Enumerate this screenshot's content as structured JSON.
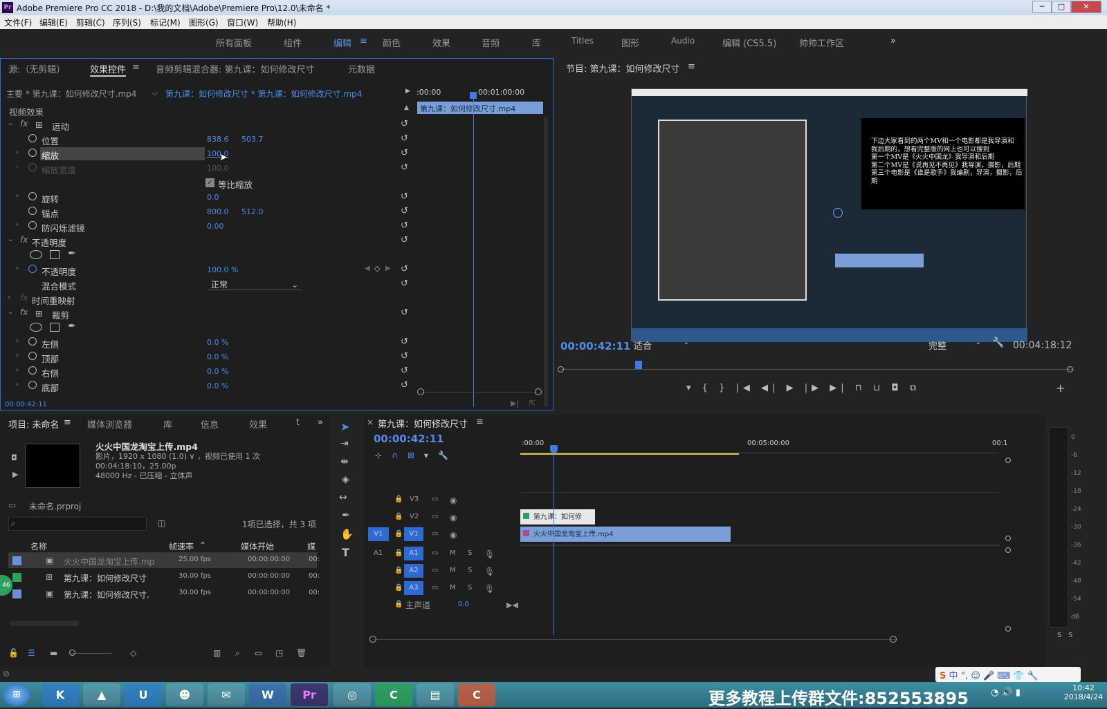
{
  "titlebar": {
    "app_icon": "Pr",
    "title": "Adobe Premiere Pro CC 2018 - D:\\我的文档\\Adobe\\Premiere Pro\\12.0\\未命名 *",
    "min": "─",
    "max": "□",
    "close": "✕"
  },
  "menu": [
    "文件(F)",
    "编辑(E)",
    "剪辑(C)",
    "序列(S)",
    "标记(M)",
    "图形(G)",
    "窗口(W)",
    "帮助(H)"
  ],
  "workspaces": [
    "所有面板",
    "组件",
    "编辑",
    "颜色",
    "效果",
    "音频",
    "库",
    "Titles",
    "图形",
    "Audio",
    "编辑 (CS5.5)",
    "帅帅工作区"
  ],
  "workspace_active": "编辑",
  "workspace_more": "»",
  "effect_controls": {
    "tabs": [
      "源:（无剪辑）",
      "效果控件",
      "音频剪辑混合器: 第九课：如何修改尺寸",
      "元数据"
    ],
    "master": "主要 * 第九课：如何修改尺寸.mp4",
    "clip": "第九课：如何修改尺寸 * 第九课：如何修改尺寸.mp4",
    "tc_start": ":00:00",
    "tc_mark": "00:01:00:00",
    "clip_bar": "第九课：如何修改尺寸.mp4",
    "section_video": "视频效果",
    "motion": "运动",
    "position": {
      "label": "位置",
      "x": "838.6",
      "y": "503.7"
    },
    "scale": {
      "label": "缩放",
      "v": "100.0"
    },
    "scale_width": {
      "label": "缩放宽度",
      "v": "100.0"
    },
    "uniform": "等比缩放",
    "rotation": {
      "label": "旋转",
      "v": "0.0"
    },
    "anchor": {
      "label": "锚点",
      "x": "800.0",
      "y": "512.0"
    },
    "flicker": {
      "label": "防闪烁滤镜",
      "v": "0.00"
    },
    "opacity_fx": "不透明度",
    "opacity": {
      "label": "不透明度",
      "v": "100.0 %"
    },
    "blend": {
      "label": "混合模式",
      "v": "正常"
    },
    "time_remap": "时间重映射",
    "crop": "裁剪",
    "left": {
      "label": "左侧",
      "v": "0.0 %"
    },
    "top": {
      "label": "顶部",
      "v": "0.0 %"
    },
    "right": {
      "label": "右侧",
      "v": "0.0 %"
    },
    "bottom": {
      "label": "底部",
      "v": "0.0 %"
    },
    "timecode": "00:00:42:11"
  },
  "program": {
    "title": "节目: 第九课：如何修改尺寸",
    "overlay_lines": [
      "下边大家看到的两个MV和一个电影都是我导演和",
      "我后期的，想看完整版的网上也可以搜到",
      "第一个MV是《火火中国龙》我导演和后期",
      "第二个MV是《说再见不再见》我导演，摄影，后期",
      "第三个电影是《谁是歌手》我编剧，导演，摄影，后期"
    ],
    "timecode": "00:00:42:11",
    "fit": "适合",
    "quality": "完整",
    "duration": "00:04:18:12"
  },
  "project": {
    "tabs": [
      "项目: 未命名",
      "媒体浏览器",
      "库",
      "信息",
      "效果",
      "t"
    ],
    "clip_name": "火火中国龙淘宝上传.mp4",
    "clip_info1": "影片，1920 x 1080 (1.0) ∨ ，视频已使用 1 次",
    "clip_info2": "00:04:18:10，25.00p",
    "clip_info3": "48000 Hz - 已压缩 - 立体声",
    "proj_file": "未命名.prproj",
    "selection": "1项已选择，共 3 项",
    "cols": [
      "名称",
      "帧速率",
      "媒体开始",
      "媒"
    ],
    "items": [
      {
        "name": "火火中国龙淘宝上传.mp",
        "fps": "25.00 fps",
        "start": "00:00:00:00",
        "m": "00:",
        "color": "#6f8fd8"
      },
      {
        "name": "第九课：如何修改尺寸",
        "fps": "30.00 fps",
        "start": "00:00:00:00",
        "m": "00:",
        "color": "#2ea060"
      },
      {
        "name": "第九课：如何修改尺寸.",
        "fps": "30.00 fps",
        "start": "00:00:00:00",
        "m": "00:",
        "color": "#6f8fd8"
      }
    ],
    "badge": "46"
  },
  "timeline": {
    "title": "第九课：如何修改尺寸",
    "timecode": "00:00:42:11",
    "ruler": [
      ":00:00",
      "00:05:00:00",
      "00:1"
    ],
    "video_tracks": [
      "V3",
      "V2",
      "V1"
    ],
    "audio_tracks": [
      "A1",
      "A2",
      "A3"
    ],
    "master": "主声道",
    "master_v": "0.0",
    "clip_v2": "第九课：如何修",
    "clip_v1": "火火中国龙淘宝上传.mp4"
  },
  "meter": {
    "ticks": [
      "0",
      "-6",
      "-12",
      "-18",
      "-24",
      "-30",
      "-36",
      "-42",
      "-48",
      "-54",
      "dB"
    ],
    "solo": "S"
  },
  "taskbar": {
    "banner": "更多教程上传群文件:852553895",
    "time": "10:42",
    "date": "2018/4/24",
    "ime": "中"
  },
  "colors": {
    "accent": "#2c6bd4",
    "value": "#4d8de8",
    "playhead": "#3d7be6"
  }
}
